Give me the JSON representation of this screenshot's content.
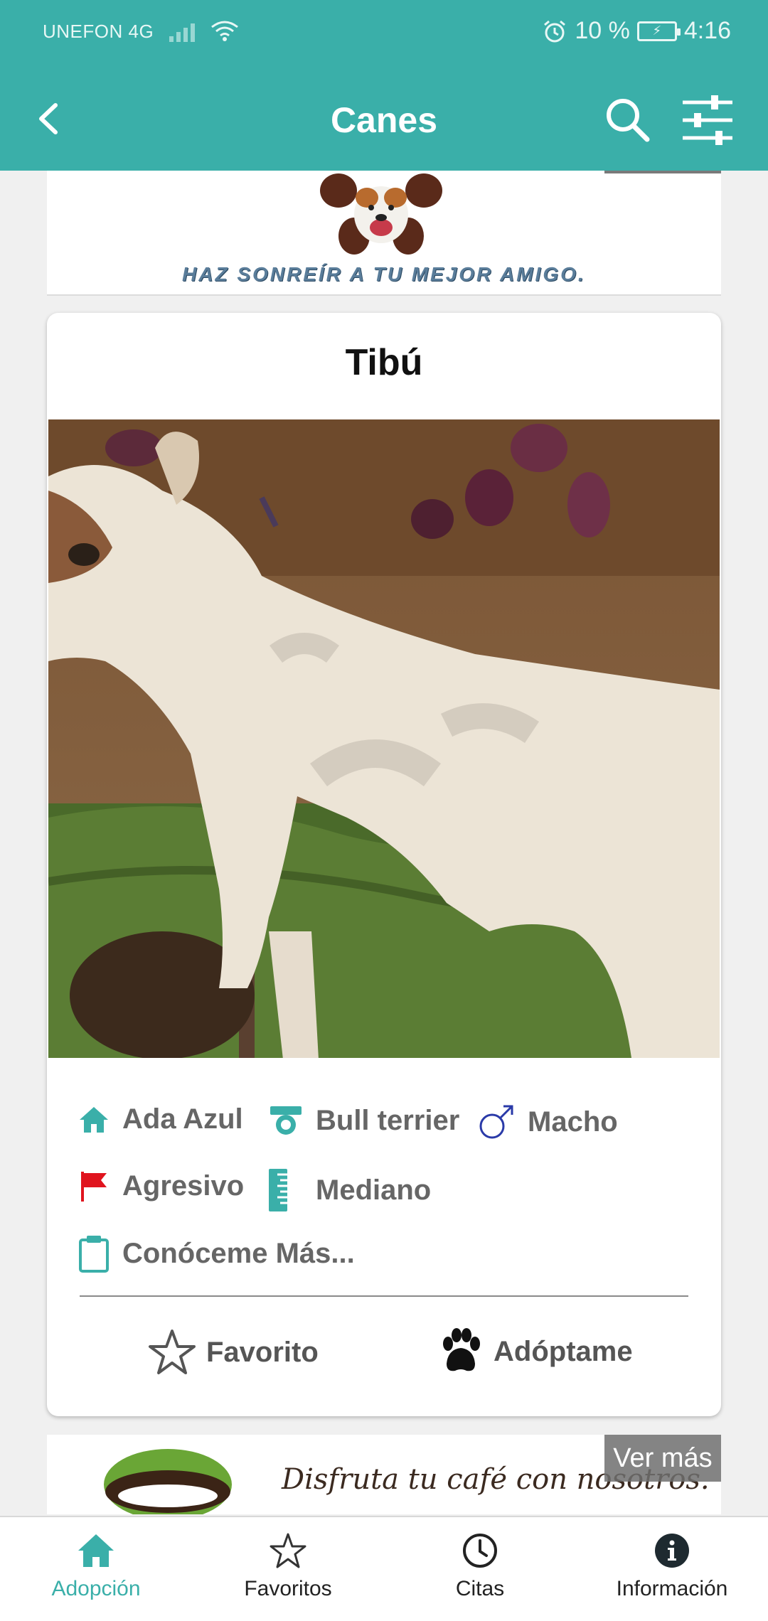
{
  "status_bar": {
    "carrier": "UNEFON 4G",
    "battery": "10 %",
    "time": "4:16"
  },
  "app_bar": {
    "title": "Canes"
  },
  "top_banner": {
    "slogan": "HAZ SONREÍR A TU MEJOR AMIGO."
  },
  "card": {
    "name": "Tibú",
    "attributes": {
      "shelter": "Ada Azul",
      "breed": "Bull terrier",
      "sex": "Macho",
      "temperament": "Agresivo",
      "size": "Mediano",
      "more": "Conóceme Más..."
    },
    "actions": {
      "favorite": "Favorito",
      "adopt": "Adóptame"
    }
  },
  "bottom_banner": {
    "text": "Disfruta tu café con nosotros.",
    "more_button": "Ver más"
  },
  "bottom_nav": [
    {
      "label": "Adopción",
      "icon": "home-icon",
      "active": true
    },
    {
      "label": "Favoritos",
      "icon": "star-icon",
      "active": false
    },
    {
      "label": "Citas",
      "icon": "clock-icon",
      "active": false
    },
    {
      "label": "Información",
      "icon": "info-icon",
      "active": false
    }
  ],
  "colors": {
    "primary": "#3aafa9",
    "male_icon": "#2a3aa8",
    "flag_icon": "#e0141e"
  }
}
